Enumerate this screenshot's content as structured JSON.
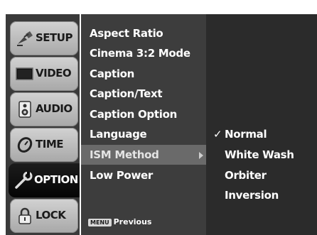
{
  "tabs": [
    {
      "label": "SETUP",
      "icon": "satellite-icon"
    },
    {
      "label": "VIDEO",
      "icon": "tv-screen-icon"
    },
    {
      "label": "AUDIO",
      "icon": "speaker-icon"
    },
    {
      "label": "TIME",
      "icon": "clock-icon"
    },
    {
      "label": "OPTION",
      "icon": "wrench-icon",
      "active": true
    },
    {
      "label": "LOCK",
      "icon": "padlock-icon"
    }
  ],
  "menu": {
    "items": [
      {
        "label": "Aspect Ratio"
      },
      {
        "label": "Cinema 3:2 Mode"
      },
      {
        "label": "Caption"
      },
      {
        "label": "Caption/Text"
      },
      {
        "label": "Caption Option"
      },
      {
        "label": "Language"
      },
      {
        "label": "ISM Method",
        "selected": true
      },
      {
        "label": "Low Power"
      }
    ],
    "footer": {
      "key": "MENU",
      "label": "Previous"
    }
  },
  "submenu": {
    "items": [
      {
        "label": "Normal",
        "checked": true
      },
      {
        "label": "White Wash"
      },
      {
        "label": "Orbiter"
      },
      {
        "label": "Inversion"
      }
    ]
  },
  "colors": {
    "active_tab": "#0a0a0a",
    "highlight": "#6a6a6a",
    "background": "#2b2b2b"
  }
}
